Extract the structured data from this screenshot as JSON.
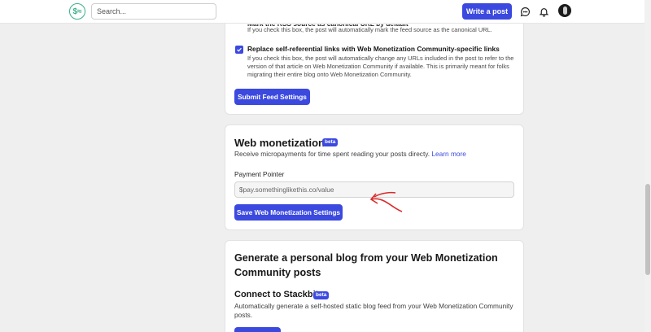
{
  "header": {
    "logo_text": "$≈",
    "search_placeholder": "Search...",
    "write_post_label": "Write a post",
    "icons": [
      "chat-icon",
      "bell-icon",
      "avatar"
    ]
  },
  "feed_settings": {
    "option1_label_partial": "Mark the RSS source as canonical URL by default",
    "option1_help": "If you check this box, the post will automatically mark the feed source as the canonical URL.",
    "option2_label": "Replace self-referential links with Web Monetization Community-specific links",
    "option2_help": "If you check this box, the post will automatically change any URLs included in the post to refer to the version of that article on Web Monetization Community if available. This is primarily meant for folks migrating their entire blog onto Web Monetization Community.",
    "option2_checked": true,
    "submit_label": "Submit Feed Settings"
  },
  "web_monetization": {
    "title": "Web monetization",
    "badge": "beta",
    "description": "Receive micropayments for time spent reading your posts directy.",
    "learn_more": "Learn more",
    "pointer_label": "Payment Pointer",
    "pointer_placeholder": "$pay.somethinglikethis.co/value",
    "save_label": "Save Web Monetization Settings"
  },
  "personal_blog": {
    "title": "Generate a personal blog from your Web Monetization Community posts",
    "stackbit_title": "Connect to Stackbit",
    "stackbit_badge": "beta",
    "stackbit_description": "Automatically generate a self-hosted static blog feed from your Web Monetization Community posts."
  },
  "colors": {
    "accent": "#3b49df",
    "logo": "#3ab08a",
    "annotation": "#d92b2b"
  }
}
